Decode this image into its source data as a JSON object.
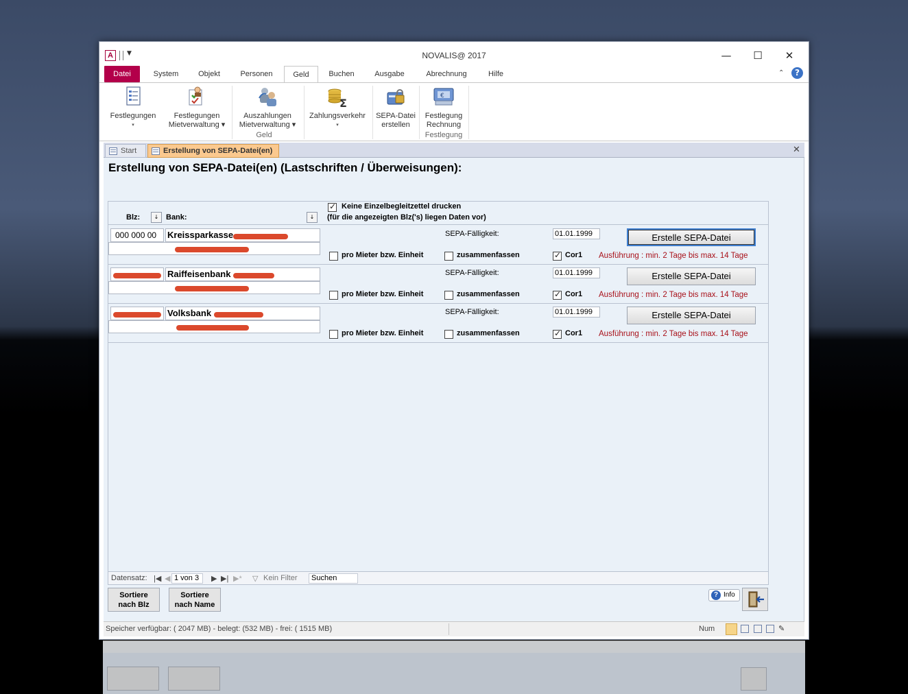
{
  "window": {
    "app_icon": "A",
    "title": "NOVALIS@ 2017",
    "minimize": "—",
    "maximize": "☐",
    "close": "✕"
  },
  "ribbon": {
    "tabs": [
      "Datei",
      "System",
      "Objekt",
      "Personen",
      "Geld",
      "Buchen",
      "Ausgabe",
      "Abrechnung",
      "Hilfe"
    ],
    "active_tab": "Geld",
    "buttons": [
      {
        "line1": "Festlegungen",
        "line2": "",
        "caret": "▾",
        "icon": "document-list-icon"
      },
      {
        "line1": "Festlegungen",
        "line2": "Mietverwaltung ▾",
        "icon": "person-check-icon"
      },
      {
        "line1": "Auszahlungen",
        "line2": "Mietverwaltung ▾",
        "icon": "people-arrow-icon"
      },
      {
        "line1": "Zahlungsverkehr",
        "line2": "",
        "caret": "▾",
        "icon": "coins-sum-icon"
      },
      {
        "line1": "SEPA-Datei",
        "line2": "erstellen",
        "icon": "lock-card-icon"
      },
      {
        "line1": "Festlegung",
        "line2": "Rechnung",
        "icon": "invoice-icon"
      }
    ],
    "groups": [
      "Geld",
      "Festlegung"
    ]
  },
  "doc_tabs": {
    "start": "Start",
    "active": "Erstellung von SEPA-Datei(en)",
    "close": "✕"
  },
  "form": {
    "title": "Erstellung von SEPA-Datei(en) (Lastschriften / Überweisungen):",
    "header": {
      "blz_label": "Blz:",
      "bank_label": "Bank:",
      "sort_glyph": "↓",
      "keine_label": "Keine Einzelbegleitzettel drucken",
      "keine_checked": true,
      "note": "(für die angezeigten Blz('s) liegen Daten vor)"
    },
    "labels": {
      "faelligkeit": "SEPA-Fälligkeit:",
      "pro_mieter": "pro Mieter bzw. Einheit",
      "zusammenfassen": "zusammenfassen",
      "cor1": "Cor1",
      "button": "Erstelle SEPA-Datei",
      "exec_note": "Ausführung : min. 2 Tage bis max. 14 Tage"
    },
    "records": [
      {
        "blz": "000 000 00",
        "bank": "Kreissparkasse",
        "date": "01.01.1999",
        "pro_mieter": false,
        "zusammenfassen": false,
        "cor1": true
      },
      {
        "blz": "",
        "bank": "Raiffeisenbank",
        "date": "01.01.1999",
        "pro_mieter": false,
        "zusammenfassen": false,
        "cor1": true
      },
      {
        "blz": "",
        "bank": "Volksbank",
        "date": "01.01.1999",
        "pro_mieter": false,
        "zusammenfassen": false,
        "cor1": true
      }
    ],
    "navigation": {
      "label": "Datensatz:",
      "position": "1 von 3",
      "filter": "Kein Filter",
      "search": "Suchen"
    },
    "buttons": {
      "sort_blz_1": "Sortiere",
      "sort_blz_2": "nach Blz",
      "sort_name_1": "Sortiere",
      "sort_name_2": "nach Name",
      "info": "Info"
    }
  },
  "statusbar": {
    "memory": "Speicher verfügbar: ( 2047 MB)  -  belegt: (532 MB)  -  frei: ( 1515 MB)",
    "num": "Num"
  },
  "colors": {
    "file_tab": "#b3004a",
    "active_doc_tab": "#fbc98f",
    "form_bg": "#eaf1f8",
    "exec_note": "#a8111a",
    "redaction": "#d8391a"
  }
}
